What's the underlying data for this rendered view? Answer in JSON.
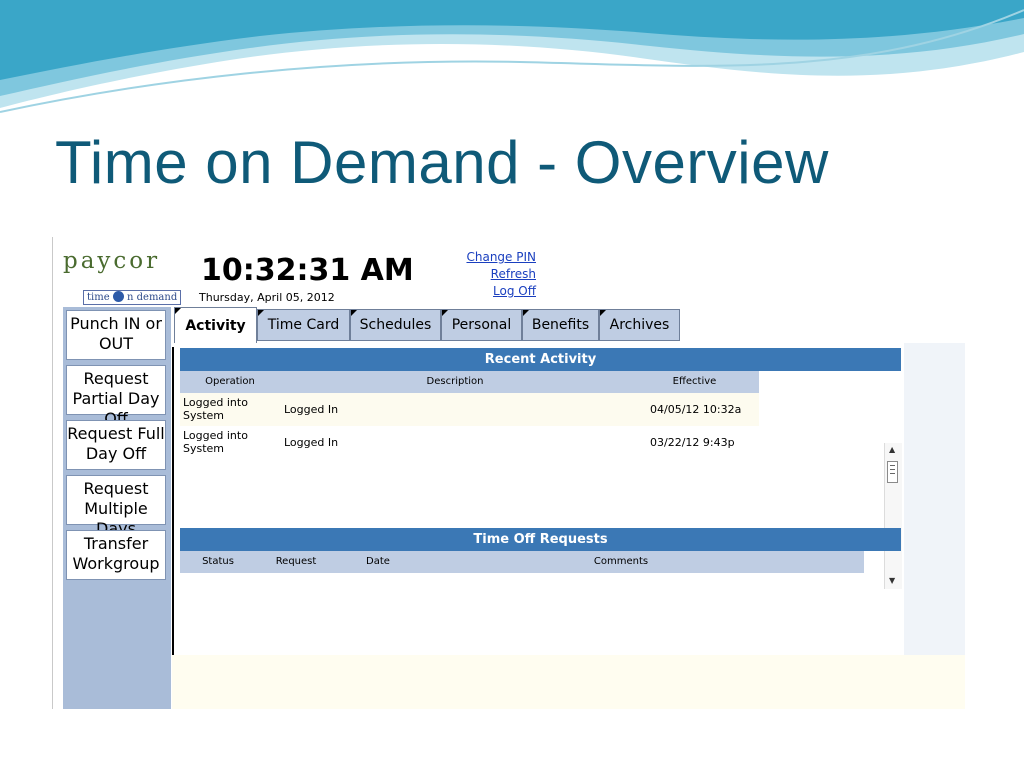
{
  "slide": {
    "title": "Time on Demand - Overview"
  },
  "brand": {
    "name": "paycor",
    "sub_left": "time",
    "sub_right": "n demand"
  },
  "header": {
    "clock": "10:32:31 AM",
    "date": "Thursday, April 05, 2012"
  },
  "links": {
    "change_pin": "Change PIN",
    "refresh": "Refresh",
    "log_off": "Log Off"
  },
  "sidebar": {
    "punch": "Punch IN or OUT",
    "partial_day": "Request Partial Day Off",
    "full_day": "Request Full Day Off",
    "multiple_days": "Request Multiple Days",
    "transfer": "Transfer Workgroup"
  },
  "tabs": {
    "activity": "Activity",
    "time_card": "Time Card",
    "schedules": "Schedules",
    "personal": "Personal",
    "benefits": "Benefits",
    "archives": "Archives"
  },
  "recent_activity": {
    "title": "Recent Activity",
    "columns": {
      "operation": "Operation",
      "description": "Description",
      "effective": "Effective"
    },
    "rows": [
      {
        "operation": "Logged into System",
        "description": "Logged In",
        "effective": "04/05/12 10:32a"
      },
      {
        "operation": "Logged into System",
        "description": "Logged In",
        "effective": "03/22/12 9:43p"
      }
    ]
  },
  "time_off": {
    "title": "Time Off Requests",
    "columns": {
      "status": "Status",
      "request": "Request",
      "date": "Date",
      "comments": "Comments"
    }
  },
  "colors": {
    "title": "#0f5a78",
    "header_bar": "#3b78b5",
    "sidebar": "#a9bcd8",
    "column_header": "#bfcde3",
    "link": "#1a3fbf"
  }
}
